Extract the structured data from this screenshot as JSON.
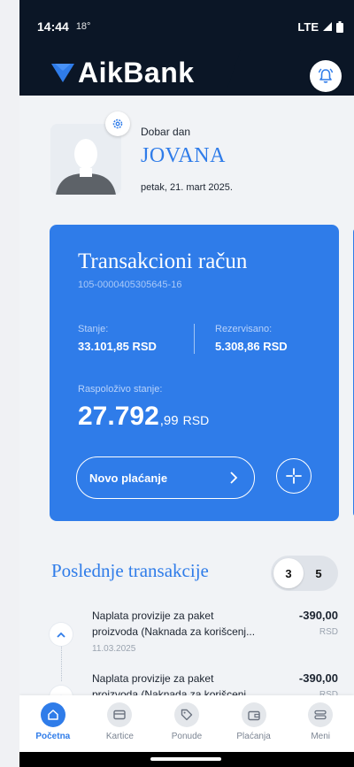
{
  "status_bar": {
    "time": "14:44",
    "temp": "18°",
    "network": "LTE"
  },
  "header": {
    "brand": "AikBank"
  },
  "profile": {
    "greeting": "Dobar dan",
    "name": "JOVANA",
    "date": "petak, 21. mart 2025."
  },
  "account": {
    "title": "Transakcioni račun",
    "number": "105-0000405305645-16",
    "balance_label": "Stanje:",
    "balance_value": "33.101,85 RSD",
    "reserved_label": "Rezervisano:",
    "reserved_value": "5.308,86 RSD",
    "available_label": "Raspoloživo stanje:",
    "available_main": "27.792",
    "available_cents": ",99",
    "available_currency": "RSD",
    "new_payment_label": "Novo plaćanje"
  },
  "transactions": {
    "title": "Poslednje transakcije",
    "toggle_options": [
      "3",
      "5"
    ],
    "toggle_selected": "3",
    "items": [
      {
        "line1": "Naplata provizije za paket",
        "line2": "proizvoda (Naknada za korišcenj...",
        "date": "11.03.2025",
        "amount": "-390,00",
        "currency": "RSD"
      },
      {
        "line1": "Naplata provizije za paket",
        "line2": "proizvoda (Naknada za korišceni...",
        "amount": "-390,00",
        "currency": "RSD"
      }
    ]
  },
  "nav": {
    "items": [
      {
        "label": "Početna",
        "icon": "home-icon",
        "active": true
      },
      {
        "label": "Kartice",
        "icon": "card-icon"
      },
      {
        "label": "Ponude",
        "icon": "tag-icon"
      },
      {
        "label": "Plaćanja",
        "icon": "wallet-icon"
      },
      {
        "label": "Meni",
        "icon": "menu-icon"
      }
    ]
  },
  "colors": {
    "brand_blue": "#2f7ce9",
    "header_dark": "#0b1626"
  }
}
